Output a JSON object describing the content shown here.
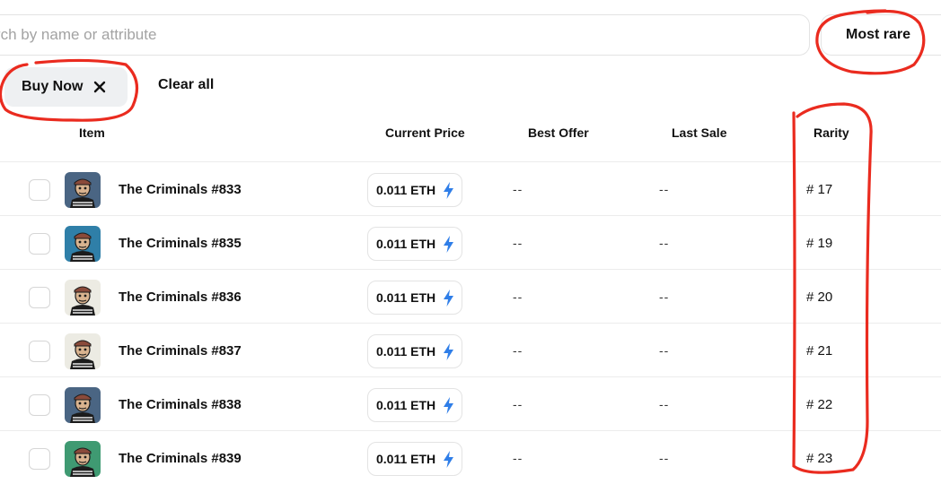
{
  "search": {
    "placeholder": "earch by name or attribute",
    "value": ""
  },
  "sort": {
    "label": "Most rare"
  },
  "filters": {
    "active": [
      {
        "label": "Buy Now",
        "close_icon": "close-icon"
      }
    ],
    "clear_label": "Clear all"
  },
  "table": {
    "headers": {
      "item": "Item",
      "price": "Current Price",
      "offer": "Best Offer",
      "sale": "Last Sale",
      "rarity": "Rarity"
    },
    "rows": [
      {
        "name": "The Criminals #833",
        "price": "0.011 ETH",
        "best_offer": "--",
        "last_sale": "--",
        "rarity": "# 17",
        "avatar_bg": "#4a6583"
      },
      {
        "name": "The Criminals #835",
        "price": "0.011 ETH",
        "best_offer": "--",
        "last_sale": "--",
        "rarity": "# 19",
        "avatar_bg": "#2f7fa8"
      },
      {
        "name": "The Criminals #836",
        "price": "0.011 ETH",
        "best_offer": "--",
        "last_sale": "--",
        "rarity": "# 20",
        "avatar_bg": "#ecebe3"
      },
      {
        "name": "The Criminals #837",
        "price": "0.011 ETH",
        "best_offer": "--",
        "last_sale": "--",
        "rarity": "# 21",
        "avatar_bg": "#ecebe3"
      },
      {
        "name": "The Criminals #838",
        "price": "0.011 ETH",
        "best_offer": "--",
        "last_sale": "--",
        "rarity": "# 22",
        "avatar_bg": "#4a6583"
      },
      {
        "name": "The Criminals #839",
        "price": "0.011 ETH",
        "best_offer": "--",
        "last_sale": "--",
        "rarity": "# 23",
        "avatar_bg": "#3f9a72"
      }
    ]
  },
  "colors": {
    "bolt": "#2f7ee8",
    "annotation": "#ea2b1f"
  }
}
